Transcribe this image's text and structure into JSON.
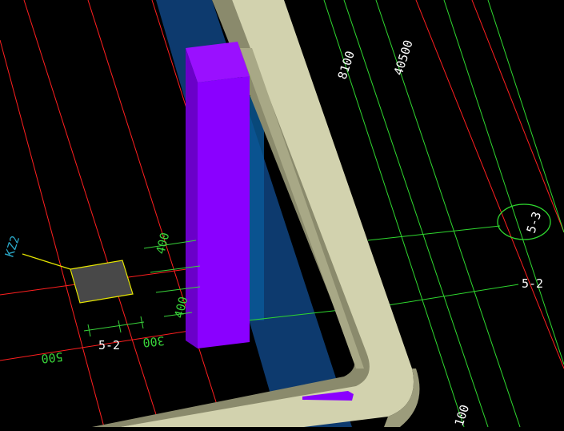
{
  "app": {
    "view": "3D CAD structural model viewport"
  },
  "colors": {
    "background": "#000000",
    "grid_red": "#ff1f1f",
    "grid_green": "#2fd82f",
    "dim_green": "#39d33a",
    "column_purple": "#8a00ff",
    "wall_beige": "#d2d2ae",
    "beam_blue": "#0d3a6e",
    "label_cyan": "#2aa8c8"
  },
  "labels": {
    "dim_8100": "8100",
    "dim_40500": "40500",
    "dim_400_top": "400",
    "dim_400_bottom": "400",
    "dim_500": "500",
    "dim_300": "300",
    "axis_5_3": "5-3",
    "axis_5_2_right": "5-2",
    "axis_5_2_left": "5-2",
    "column_tag": "KZ2",
    "bottom_dim": "100"
  }
}
